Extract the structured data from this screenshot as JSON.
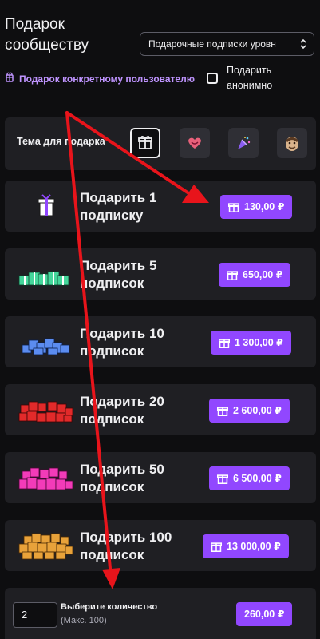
{
  "header": {
    "title": "Подарок сообществу",
    "tier_select": {
      "value": "Подарочные подписки уровн",
      "icon": "chevron-updown-icon"
    }
  },
  "gift_user": {
    "label": "Подарок конкретному пользователю",
    "icon": "gift-user-icon"
  },
  "anonymous": {
    "label": "Подарить анонимно",
    "checked": false
  },
  "theme": {
    "label": "Тема для подарка",
    "options": [
      {
        "icon": "gift-icon",
        "selected": true
      },
      {
        "icon": "heart-icon",
        "selected": false
      },
      {
        "icon": "party-popper-icon",
        "selected": false
      },
      {
        "icon": "emote-face-icon",
        "selected": false
      }
    ]
  },
  "gifts": [
    {
      "label": "Подарить 1 подписку",
      "price": "130,00 ₽",
      "color": "#ffffff"
    },
    {
      "label": "Подарить 5 подписок",
      "price": "650,00 ₽",
      "color": "#45d69b"
    },
    {
      "label": "Подарить 10 подписок",
      "price": "1 300,00 ₽",
      "color": "#5b8cf0"
    },
    {
      "label": "Подарить 20 подписок",
      "price": "2 600,00 ₽",
      "color": "#e22a2a"
    },
    {
      "label": "Подарить 50 подписок",
      "price": "6 500,00 ₽",
      "color": "#f23bb8"
    },
    {
      "label": "Подарить 100 подписок",
      "price": "13 000,00 ₽",
      "color": "#e8a23a"
    }
  ],
  "custom": {
    "quantity": "2",
    "label": "Выберите количество",
    "sub": "(Макс. 100)",
    "price": "260,00 ₽"
  },
  "colors": {
    "accent": "#9147ff",
    "annotation_arrow": "#e8141b",
    "link": "#bf94ff"
  }
}
